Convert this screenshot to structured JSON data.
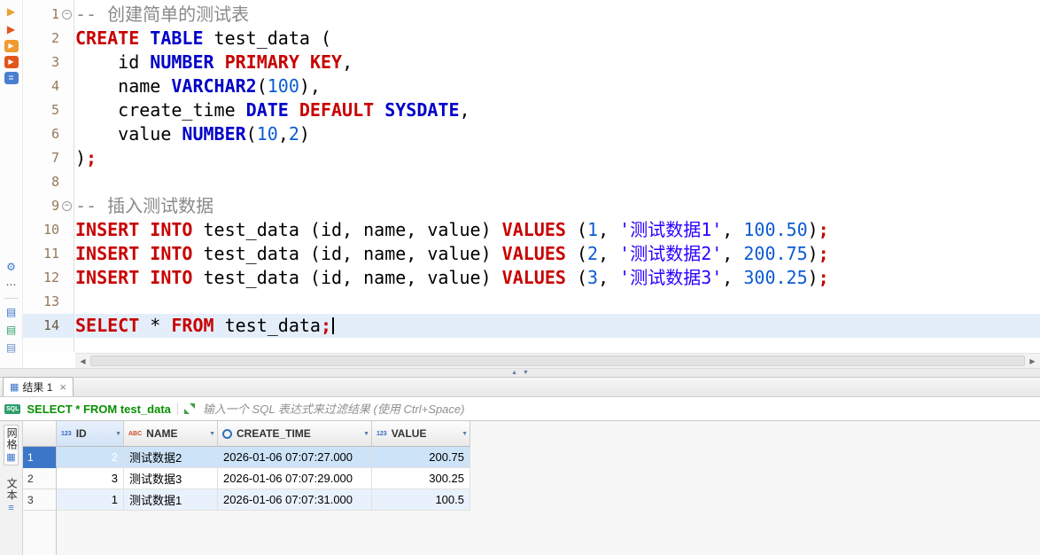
{
  "colors": {
    "accent_blue": "#3b74c8",
    "selection_blue": "#316ac5",
    "row_selected_bg": "#cde3f8",
    "row_striped_bg": "#e9f2fc",
    "current_line_bg": "#e4eefb",
    "keyword_red": "#c80000",
    "type_blue": "#0000c8",
    "number_blue": "#0b5bd3",
    "string_blue": "#2a00ff",
    "comment_gray": "#8a8a8a",
    "filter_green": "#089000"
  },
  "icons": {
    "left_arrow": "◀",
    "right_arrow": "▶",
    "up_arrow": "▲",
    "down_arrow": "▼",
    "dropdown": "▼",
    "grid": "▦",
    "text": "≡",
    "close": "×",
    "sql_badge": "SQL",
    "num_type": "123",
    "str_type": "ABC",
    "fold_minus": "−"
  },
  "toolbar": {
    "top": [
      {
        "name": "execute-statement-icon",
        "glyph": "▶",
        "fg": "#e8a32f",
        "bg": ""
      },
      {
        "name": "execute-statement-new-tab-icon",
        "glyph": "▶",
        "fg": "#e2561b",
        "bg": ""
      },
      {
        "name": "execute-script-icon",
        "glyph": "▶",
        "fg": "#ffffff",
        "bg": "#ef9b2f"
      },
      {
        "name": "execute-script-new-tab-icon",
        "glyph": "▶",
        "fg": "#ffffff",
        "bg": "#e2561b"
      },
      {
        "name": "explain-plan-icon",
        "glyph": "≣",
        "fg": "#ffffff",
        "bg": "#4a7fd0"
      }
    ],
    "bottom": [
      {
        "name": "settings-gear-icon",
        "glyph": "⚙",
        "fg": "#3b74c8",
        "bg": ""
      },
      {
        "name": "more-actions-icon",
        "glyph": "⋯",
        "fg": "#555555",
        "bg": ""
      },
      {
        "sep": true
      },
      {
        "name": "sql-file-icon",
        "glyph": "▤",
        "fg": "#3b74c8",
        "bg": ""
      },
      {
        "name": "new-sql-file-icon",
        "glyph": "▤",
        "fg": "#2d9e6b",
        "bg": ""
      },
      {
        "name": "log-file-icon",
        "glyph": "▤",
        "fg": "#6b8cc9",
        "bg": ""
      }
    ]
  },
  "editor": {
    "current_line": 14,
    "lines": [
      {
        "num": 1,
        "fold": true,
        "tokens": [
          [
            "c",
            "-- 创建简单的测试表"
          ]
        ]
      },
      {
        "num": 2,
        "fold": false,
        "tokens": [
          [
            "k",
            "CREATE"
          ],
          [
            "p",
            " "
          ],
          [
            "t",
            "TABLE"
          ],
          [
            "p",
            " test_data ("
          ]
        ]
      },
      {
        "num": 3,
        "fold": false,
        "tokens": [
          [
            "p",
            "    id "
          ],
          [
            "t",
            "NUMBER"
          ],
          [
            "p",
            " "
          ],
          [
            "k",
            "PRIMARY"
          ],
          [
            "p",
            " "
          ],
          [
            "k",
            "KEY"
          ],
          [
            "p",
            ","
          ]
        ]
      },
      {
        "num": 4,
        "fold": false,
        "tokens": [
          [
            "p",
            "    name "
          ],
          [
            "t",
            "VARCHAR2"
          ],
          [
            "p",
            "("
          ],
          [
            "n",
            "100"
          ],
          [
            "p",
            "),"
          ]
        ]
      },
      {
        "num": 5,
        "fold": false,
        "tokens": [
          [
            "p",
            "    create_time "
          ],
          [
            "t",
            "DATE"
          ],
          [
            "p",
            " "
          ],
          [
            "k",
            "DEFAULT"
          ],
          [
            "p",
            " "
          ],
          [
            "t",
            "SYSDATE"
          ],
          [
            "p",
            ","
          ]
        ]
      },
      {
        "num": 6,
        "fold": false,
        "tokens": [
          [
            "p",
            "    value "
          ],
          [
            "t",
            "NUMBER"
          ],
          [
            "p",
            "("
          ],
          [
            "n",
            "10"
          ],
          [
            "p",
            ","
          ],
          [
            "n",
            "2"
          ],
          [
            "p",
            ")"
          ]
        ]
      },
      {
        "num": 7,
        "fold": false,
        "tokens": [
          [
            "p",
            ")"
          ],
          [
            "d",
            ";"
          ]
        ]
      },
      {
        "num": 8,
        "fold": false,
        "tokens": []
      },
      {
        "num": 9,
        "fold": true,
        "tokens": [
          [
            "c",
            "-- 插入测试数据"
          ]
        ]
      },
      {
        "num": 10,
        "fold": false,
        "tokens": [
          [
            "k",
            "INSERT"
          ],
          [
            "p",
            " "
          ],
          [
            "k",
            "INTO"
          ],
          [
            "p",
            " test_data (id, name, value) "
          ],
          [
            "k",
            "VALUES"
          ],
          [
            "p",
            " ("
          ],
          [
            "n",
            "1"
          ],
          [
            "p",
            ", "
          ],
          [
            "s",
            "'测试数据1'"
          ],
          [
            "p",
            ", "
          ],
          [
            "n",
            "100.50"
          ],
          [
            "p",
            ")"
          ],
          [
            "d",
            ";"
          ]
        ]
      },
      {
        "num": 11,
        "fold": false,
        "tokens": [
          [
            "k",
            "INSERT"
          ],
          [
            "p",
            " "
          ],
          [
            "k",
            "INTO"
          ],
          [
            "p",
            " test_data (id, name, value) "
          ],
          [
            "k",
            "VALUES"
          ],
          [
            "p",
            " ("
          ],
          [
            "n",
            "2"
          ],
          [
            "p",
            ", "
          ],
          [
            "s",
            "'测试数据2'"
          ],
          [
            "p",
            ", "
          ],
          [
            "n",
            "200.75"
          ],
          [
            "p",
            ")"
          ],
          [
            "d",
            ";"
          ]
        ]
      },
      {
        "num": 12,
        "fold": false,
        "tokens": [
          [
            "k",
            "INSERT"
          ],
          [
            "p",
            " "
          ],
          [
            "k",
            "INTO"
          ],
          [
            "p",
            " test_data (id, name, value) "
          ],
          [
            "k",
            "VALUES"
          ],
          [
            "p",
            " ("
          ],
          [
            "n",
            "3"
          ],
          [
            "p",
            ", "
          ],
          [
            "s",
            "'测试数据3'"
          ],
          [
            "p",
            ", "
          ],
          [
            "n",
            "300.25"
          ],
          [
            "p",
            ")"
          ],
          [
            "d",
            ";"
          ]
        ]
      },
      {
        "num": 13,
        "fold": false,
        "tokens": []
      },
      {
        "num": 14,
        "fold": false,
        "tokens": [
          [
            "k",
            "SELECT"
          ],
          [
            "p",
            " * "
          ],
          [
            "k",
            "FROM"
          ],
          [
            "p",
            " test_data"
          ],
          [
            "d",
            ";"
          ]
        ]
      }
    ]
  },
  "results": {
    "tab_label": "结果 1",
    "filter": {
      "query": "SELECT * FROM test_data",
      "placeholder": "输入一个 SQL 表达式来过滤结果 (使用 Ctrl+Space)"
    },
    "side_tabs": [
      {
        "label": "网格"
      },
      {
        "label": "文本"
      }
    ],
    "table": {
      "columns": [
        {
          "label": "ID",
          "type": "num",
          "width": 76,
          "align": "right"
        },
        {
          "label": "NAME",
          "type": "str",
          "width": 106,
          "align": "left"
        },
        {
          "label": "CREATE_TIME",
          "type": "date",
          "width": 174,
          "align": "left"
        },
        {
          "label": "VALUE",
          "type": "num",
          "width": 111,
          "align": "right"
        }
      ],
      "rows": [
        {
          "num": "1",
          "state": "selected",
          "cells": [
            "2",
            "测试数据2",
            "2026-01-06 07:07:27.000",
            "200.75"
          ]
        },
        {
          "num": "2",
          "state": "plain",
          "cells": [
            "3",
            "测试数据3",
            "2026-01-06 07:07:29.000",
            "300.25"
          ]
        },
        {
          "num": "3",
          "state": "striped",
          "cells": [
            "1",
            "测试数据1",
            "2026-01-06 07:07:31.000",
            "100.5"
          ]
        }
      ],
      "active_cell": {
        "row": 0,
        "col": 0
      }
    }
  }
}
